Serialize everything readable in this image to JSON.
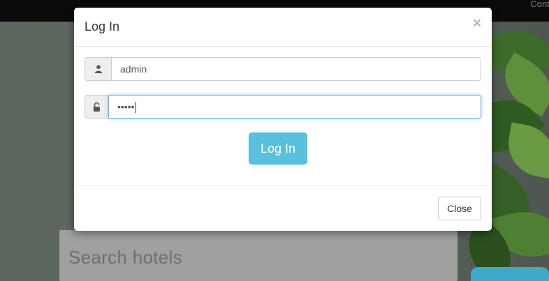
{
  "navbar": {
    "link_label": "Conta"
  },
  "search": {
    "placeholder": "Search hotels"
  },
  "modal": {
    "title": "Log In",
    "close_glyph": "×",
    "username": {
      "value": "admin",
      "icon": "user-icon"
    },
    "password": {
      "value": "•••••",
      "icon": "lock-icon"
    },
    "login_label": "Log In",
    "close_label": "Close"
  },
  "colors": {
    "primary_button": "#5bc0de",
    "focus_border": "#66afe9",
    "navbar": "#0b0b0b"
  }
}
